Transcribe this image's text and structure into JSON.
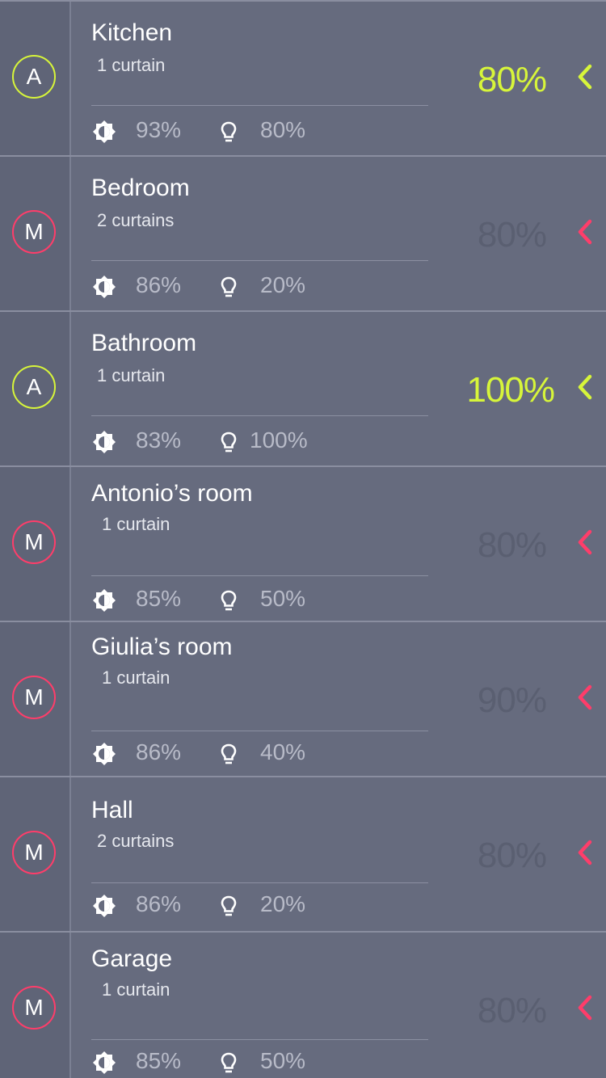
{
  "colors": {
    "auto": "#d7f53a",
    "manual": "#ff3d6a",
    "background": "#666b7e",
    "dim_value": "#5a5f71"
  },
  "rooms": [
    {
      "mode": "A",
      "name": "Kitchen",
      "curtains": "1 curtain",
      "light_sensor": "93%",
      "lamp": "80%",
      "position": "80%",
      "active": true
    },
    {
      "mode": "M",
      "name": "Bedroom",
      "curtains": "2 curtains",
      "light_sensor": "86%",
      "lamp": "20%",
      "position": "80%",
      "active": false
    },
    {
      "mode": "A",
      "name": "Bathroom",
      "curtains": "1 curtain",
      "light_sensor": "83%",
      "lamp": "100%",
      "position": "100%",
      "active": true
    },
    {
      "mode": "M",
      "name": "Antonio’s room",
      "curtains": "1 curtain",
      "light_sensor": "85%",
      "lamp": "50%",
      "position": "80%",
      "active": false
    },
    {
      "mode": "M",
      "name": "Giulia’s room",
      "curtains": "1 curtain",
      "light_sensor": "86%",
      "lamp": "40%",
      "position": "90%",
      "active": false
    },
    {
      "mode": "M",
      "name": "Hall",
      "curtains": "2 curtains",
      "light_sensor": "86%",
      "lamp": "20%",
      "position": "80%",
      "active": false
    },
    {
      "mode": "M",
      "name": "Garage",
      "curtains": "1 curtain",
      "light_sensor": "85%",
      "lamp": "50%",
      "position": "80%",
      "active": false
    }
  ],
  "icons": {
    "light_sensor": "brightness-icon",
    "lamp": "bulb-icon",
    "expand": "chevron-left-icon"
  }
}
